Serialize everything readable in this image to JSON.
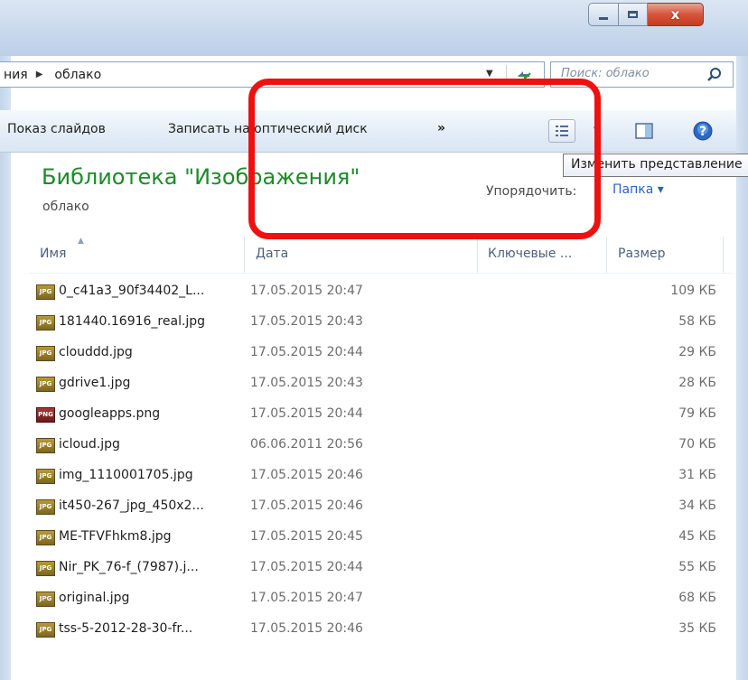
{
  "window": {
    "close_glyph": "x"
  },
  "address_bar": {
    "crumb_parent": "ния",
    "crumb_current": "облако"
  },
  "search": {
    "placeholder": "Поиск: облако"
  },
  "toolbar": {
    "slideshow": "Показ слайдов",
    "burn": "Записать на оптический диск",
    "more": "»"
  },
  "library": {
    "title": "Библиотека \"Изображения\"",
    "subtitle": "облако",
    "arrange_by_label": "Упорядочить:",
    "arrange_by_value": "Папка ▾"
  },
  "tooltip": {
    "text": "Изменить представление"
  },
  "columns": {
    "name": "Имя",
    "date": "Дата",
    "tags": "Ключевые ...",
    "size": "Размер"
  },
  "files": [
    {
      "name": "0_c41a3_90f34402_L...",
      "date": "17.05.2015 20:47",
      "size": "109 КБ",
      "type": "JPG"
    },
    {
      "name": "181440.16916_real.jpg",
      "date": "17.05.2015 20:43",
      "size": "58 КБ",
      "type": "JPG"
    },
    {
      "name": "clouddd.jpg",
      "date": "17.05.2015 20:44",
      "size": "29 КБ",
      "type": "JPG"
    },
    {
      "name": "gdrive1.jpg",
      "date": "17.05.2015 20:43",
      "size": "28 КБ",
      "type": "JPG"
    },
    {
      "name": "googleapps.png",
      "date": "17.05.2015 20:44",
      "size": "79 КБ",
      "type": "PNG"
    },
    {
      "name": "icloud.jpg",
      "date": "06.06.2011 20:56",
      "size": "70 КБ",
      "type": "JPG"
    },
    {
      "name": "img_1110001705.jpg",
      "date": "17.05.2015 20:46",
      "size": "31 КБ",
      "type": "JPG"
    },
    {
      "name": "it450-267_jpg_450x2...",
      "date": "17.05.2015 20:46",
      "size": "34 КБ",
      "type": "JPG"
    },
    {
      "name": "ME-TFVFhkm8.jpg",
      "date": "17.05.2015 20:45",
      "size": "45 КБ",
      "type": "JPG"
    },
    {
      "name": "Nir_PK_76-f_(7987).j...",
      "date": "17.05.2015 20:44",
      "size": "55 КБ",
      "type": "JPG"
    },
    {
      "name": "original.jpg",
      "date": "17.05.2015 20:47",
      "size": "68 КБ",
      "type": "JPG"
    },
    {
      "name": "tss-5-2012-28-30-fr...",
      "date": "17.05.2015 20:46",
      "size": "35 КБ",
      "type": "JPG"
    }
  ],
  "colors": {
    "library_title": "#1e8a2b",
    "highlight": "#ee1111",
    "link": "#2a63c7"
  }
}
